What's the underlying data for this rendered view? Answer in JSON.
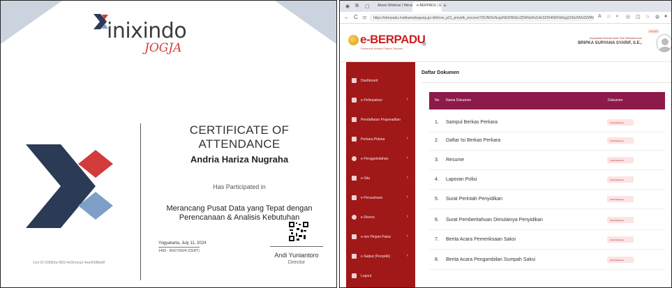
{
  "certificate": {
    "logo_text": "inixindo",
    "logo_sub": "JOGJA",
    "title": "CERTIFICATE OF ATTENDANCE",
    "recipient": "Andria Hariza Nugraha",
    "participated": "Has Participated in",
    "course_line1": "Merancang Pusat Data yang Tepat dengan",
    "course_line2": "Perencanaan & Analisis Kebutuhan",
    "date": "Yogyakarta, July 11, 2024",
    "cert_code": "1400 - INX/7/2024 (CERT)",
    "signer": "Andi Yuniantoro",
    "signer_role": "Director",
    "cert_id": "Cert ID 0358f3a-f959-4e09-bea2-4ea4308fa98",
    "colors": {
      "navy": "#2b3a55",
      "red": "#d23b3b",
      "blue": "#7ea0c7"
    }
  },
  "browser": {
    "tabs": [
      {
        "label": "Akses Webinar | Merancang Pu..."
      },
      {
        "label": "e-BERPADU | Elektronik Berkas Pi..."
      }
    ],
    "new_tab": "+",
    "url": "https://eberpadu.mahkamahagung.go.id/show_p21_pmyidk_process?Z6JNDIzNzgxNDZiNGEzZDhlNzhhZmE3ZDI4NDFkNzg2Zi0zZWU0ZWNhMzM2...",
    "back": "←",
    "reload": "C",
    "ext_icons": [
      "A",
      "☆",
      "◐",
      "◎",
      "◫",
      "☆",
      "◍",
      "●"
    ]
  },
  "app": {
    "brand": "e-BERPADU",
    "brand_sub": "Elektronik Berkas Pidana Terpadu",
    "user_badge": "Penyidik",
    "user_org": "Kepolisian Daerah Aceh Sat Ditreskrimsus",
    "user_name": "BRIPKA SURYANA SYARIF, S.E.,",
    "hamburger": "≡",
    "sidebar": [
      {
        "label": "Dashboard",
        "arrow": ""
      },
      {
        "label": "e-Pelimpahan",
        "arrow": "›"
      },
      {
        "label": "Pendaftaran Praperadilan",
        "arrow": ""
      },
      {
        "label": "Perkara Pidana",
        "arrow": "›"
      },
      {
        "label": "e-Penggeledahan",
        "arrow": "›"
      },
      {
        "label": "e-Sita",
        "arrow": "›"
      },
      {
        "label": "e-Perusahaan",
        "arrow": "›"
      },
      {
        "label": "e-Diversi",
        "arrow": "›"
      },
      {
        "label": "e-Izin Pinjam Pakai",
        "arrow": "›"
      },
      {
        "label": "e-Salput (Penyidik)",
        "arrow": "›"
      },
      {
        "label": "Logout",
        "arrow": ""
      }
    ],
    "section_title": "Daftar Dokumen",
    "table": {
      "headers": {
        "no": "No",
        "name": "Nama Dokumen",
        "doc": "Dokumen"
      },
      "button_label": "Lihat Dokumen",
      "rows": [
        {
          "no": "1.",
          "name": "Sampul Berkas Perkara"
        },
        {
          "no": "2.",
          "name": "Daftar Isi Berkas Perkara"
        },
        {
          "no": "3.",
          "name": "Resume"
        },
        {
          "no": "4.",
          "name": "Laporan Polisi"
        },
        {
          "no": "5.",
          "name": "Surat Perintah Penyidikan"
        },
        {
          "no": "6.",
          "name": "Surat Pemberitahuan Dimulainya Penyidikan"
        },
        {
          "no": "7.",
          "name": "Berita Acara Pemeriksaan Saksi"
        },
        {
          "no": "8.",
          "name": "Berita Acara Pengambilan Sumpah Saksi"
        }
      ]
    },
    "colors": {
      "sidebar": "#a01818",
      "table_header": "#8c1a4a",
      "brand": "#cc1f1f"
    }
  }
}
